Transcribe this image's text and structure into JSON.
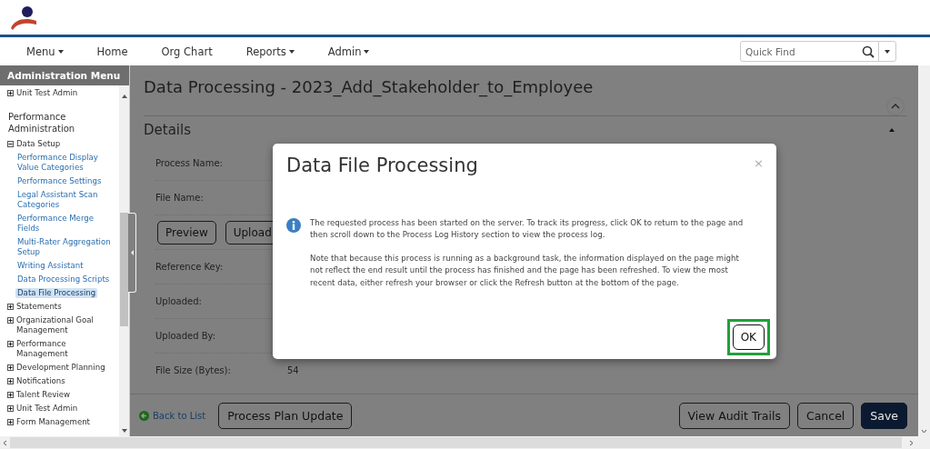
{
  "nav": {
    "items": [
      {
        "label": "Menu",
        "dropdown": true
      },
      {
        "label": "Home",
        "dropdown": false
      },
      {
        "label": "Org Chart",
        "dropdown": false
      },
      {
        "label": "Reports",
        "dropdown": true
      },
      {
        "label": "Admin",
        "dropdown": true
      }
    ],
    "quick_find": {
      "placeholder": "Quick Find"
    }
  },
  "sidebar": {
    "title": "Administration Menu",
    "items": [
      {
        "kind": "group",
        "label": "Unit Test Admin",
        "expanded": false
      },
      {
        "kind": "heading",
        "label": "Performance Administration"
      },
      {
        "kind": "group",
        "label": "Data Setup",
        "expanded": true,
        "children": [
          {
            "label": "Performance Display Value Categories",
            "selected": false
          },
          {
            "label": "Performance Settings",
            "selected": false
          },
          {
            "label": "Legal Assistant Scan Categories",
            "selected": false
          },
          {
            "label": "Performance Merge Fields",
            "selected": false
          },
          {
            "label": "Multi-Rater Aggregation Setup",
            "selected": false
          },
          {
            "label": "Writing Assistant",
            "selected": false
          },
          {
            "label": "Data Processing Scripts",
            "selected": false
          },
          {
            "label": "Data File Processing",
            "selected": true
          }
        ]
      },
      {
        "kind": "group",
        "label": "Statements",
        "expanded": false
      },
      {
        "kind": "group",
        "label": "Organizational Goal Management",
        "expanded": false
      },
      {
        "kind": "group",
        "label": "Performance Management",
        "expanded": false
      },
      {
        "kind": "group",
        "label": "Development Planning",
        "expanded": false
      },
      {
        "kind": "group",
        "label": "Notifications",
        "expanded": false
      },
      {
        "kind": "group",
        "label": "Talent Review",
        "expanded": false
      },
      {
        "kind": "group",
        "label": "Unit Test Admin",
        "expanded": false
      },
      {
        "kind": "group",
        "label": "Form Management",
        "expanded": false
      }
    ]
  },
  "page": {
    "title": "Data Processing - 2023_Add_Stakeholder_to_Employee",
    "section": "Details",
    "fields": [
      {
        "kind": "field",
        "label": "Process Name:"
      },
      {
        "kind": "field",
        "label": "File Name:"
      },
      {
        "kind": "buttons",
        "buttons": [
          "Preview",
          "Upload"
        ]
      },
      {
        "kind": "field",
        "label": "Reference Key:"
      },
      {
        "kind": "field",
        "label": "Uploaded:"
      },
      {
        "kind": "field",
        "label": "Uploaded By:"
      },
      {
        "kind": "field",
        "label": "File Size (Bytes):",
        "value": "54"
      }
    ],
    "back_link": "Back to List",
    "left_buttons": [
      "Process Plan Update"
    ],
    "right_buttons": [
      {
        "label": "View Audit Trails",
        "primary": false
      },
      {
        "label": "Cancel",
        "primary": false
      },
      {
        "label": "Save",
        "primary": true
      }
    ]
  },
  "dialog": {
    "title": "Data File Processing",
    "close": "×",
    "paragraphs": [
      "The requested process has been started on the server. To track its progress, click OK to return to the page and then scroll down to the Process Log History section to view the process log.",
      "Note that because this process is running as a background task, the information displayed on the page might not reflect the end result until the process has finished and the page has been refreshed. To view the most recent data, either refresh your browser or click the Refresh button at the bottom of the page."
    ],
    "ok_button": {
      "label": "OK",
      "highlighted": true
    }
  }
}
